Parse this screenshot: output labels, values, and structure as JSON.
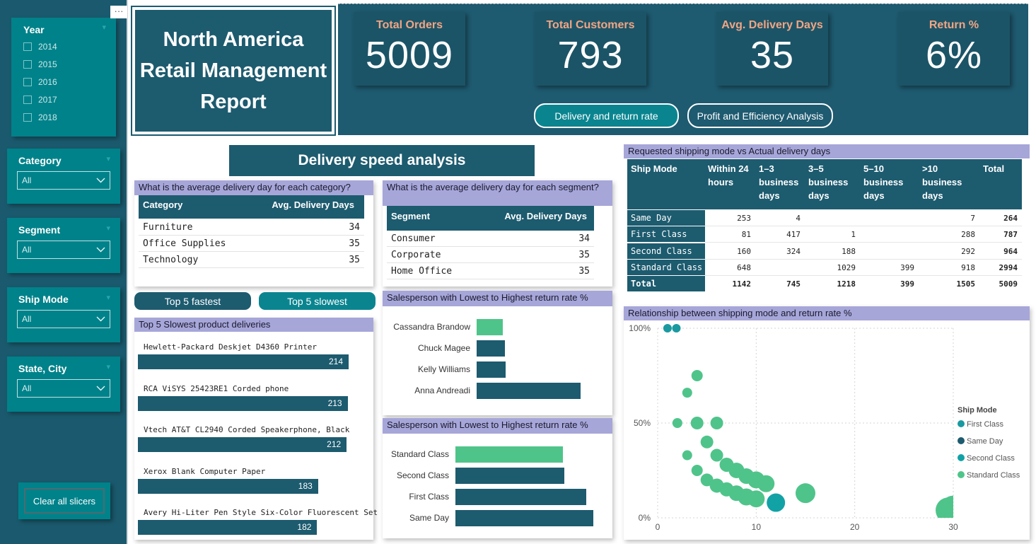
{
  "sidebar": {
    "year": {
      "title": "Year",
      "options": [
        "2014",
        "2015",
        "2016",
        "2017",
        "2018"
      ]
    },
    "category": {
      "title": "Category",
      "value": "All"
    },
    "segment": {
      "title": "Segment",
      "value": "All"
    },
    "ship_mode": {
      "title": "Ship Mode",
      "value": "All"
    },
    "state_city": {
      "title": "State, City",
      "value": "All"
    },
    "clear_label": "Clear all slicers",
    "more_label": "···"
  },
  "header": {
    "title_lines": [
      "North America",
      "Retail Management",
      "Report"
    ],
    "kpis": [
      {
        "label": "Total Orders",
        "value": "5009"
      },
      {
        "label": "Total Customers",
        "value": "793"
      },
      {
        "label": "Avg. Delivery Days",
        "value": "35"
      },
      {
        "label": "Return %",
        "value": "6%"
      }
    ],
    "nav": [
      "Delivery and return rate",
      "Profit and Efficiency Analysis"
    ]
  },
  "section_title": "Delivery speed analysis",
  "category_table": {
    "question": "What is the average delivery day for each category?",
    "headers": [
      "Category",
      "Avg. Delivery Days"
    ],
    "rows": [
      [
        "Furniture",
        "34"
      ],
      [
        "Office Supplies",
        "35"
      ],
      [
        "Technology",
        "35"
      ]
    ]
  },
  "segment_table": {
    "question": "What is the average delivery day for each segment?",
    "headers": [
      "Segment",
      "Avg. Delivery Days"
    ],
    "rows": [
      [
        "Consumer",
        "34"
      ],
      [
        "Corporate",
        "35"
      ],
      [
        "Home Office",
        "35"
      ]
    ]
  },
  "toggles": [
    "Top 5 fastest",
    "Top 5 slowest"
  ],
  "slowest": {
    "title": "Top 5 Slowest product deliveries",
    "items": [
      {
        "name": "Hewlett-Packard Deskjet D4360 Printer",
        "value": 214
      },
      {
        "name": "RCA ViSYS 25423RE1 Corded phone",
        "value": 213
      },
      {
        "name": "Vtech AT&T CL2940 Corded Speakerphone, Black",
        "value": 212
      },
      {
        "name": "Xerox Blank Computer Paper",
        "value": 183
      },
      {
        "name": "Avery Hi-Liter Pen Style Six-Color Fluorescent Set",
        "value": 182
      }
    ]
  },
  "salesperson_chart": {
    "title": "Salesperson with Lowest to Highest return rate %",
    "bars": [
      {
        "name": "Cassandra Brandow",
        "value": 0.25,
        "color": "#4fc48a"
      },
      {
        "name": "Chuck Magee",
        "value": 0.27,
        "color": "#1d5b6f"
      },
      {
        "name": "Kelly Williams",
        "value": 0.28,
        "color": "#1d5b6f"
      },
      {
        "name": "Anna Andreadi",
        "value": 1.0,
        "color": "#1d5b6f"
      }
    ]
  },
  "shipclass_chart": {
    "title": "Salesperson with Lowest to Highest return rate %",
    "bars": [
      {
        "name": "Standard Class",
        "value": 0.78,
        "color": "#4fc48a"
      },
      {
        "name": "Second Class",
        "value": 0.79,
        "color": "#1d5b6f"
      },
      {
        "name": "First Class",
        "value": 0.95,
        "color": "#1d5b6f"
      },
      {
        "name": "Same Day",
        "value": 1.0,
        "color": "#1d5b6f"
      }
    ]
  },
  "matrix": {
    "title": "Requested shipping mode vs Actual delivery days",
    "headers": [
      "Ship Mode",
      "Within 24 hours",
      "1–3 business days",
      "3–5 business days",
      "5–10 business days",
      ">10 business days",
      "Total"
    ],
    "rows": [
      [
        "Same Day",
        "253",
        "4",
        "",
        "",
        "7",
        "264"
      ],
      [
        "First Class",
        "81",
        "417",
        "1",
        "",
        "288",
        "787"
      ],
      [
        "Second Class",
        "160",
        "324",
        "188",
        "",
        "292",
        "964"
      ],
      [
        "Standard Class",
        "648",
        "",
        "1029",
        "399",
        "918",
        "2994"
      ],
      [
        "Total",
        "1142",
        "745",
        "1218",
        "399",
        "1505",
        "5009"
      ]
    ]
  },
  "chart_data": {
    "type": "scatter",
    "title": "Relationship between shipping mode and return rate %",
    "xlim": [
      0,
      30
    ],
    "ylim": [
      0,
      100
    ],
    "x_ticks": [
      "0",
      "10",
      "20",
      "30"
    ],
    "y_ticks": [
      "0%",
      "50%",
      "100%"
    ],
    "legend_title": "Ship Mode",
    "legend_position": "right",
    "series": [
      {
        "name": "First Class",
        "color": "#1a9aa0",
        "points": [
          [
            1,
            100,
            6
          ],
          [
            1.9,
            100,
            6
          ]
        ]
      },
      {
        "name": "Same Day",
        "color": "#1d5b6f",
        "points": []
      },
      {
        "name": "Second Class",
        "color": "#11a2a6",
        "points": [
          [
            12,
            8,
            13
          ]
        ]
      },
      {
        "name": "Standard Class",
        "color": "#4fc48a",
        "points": [
          [
            4,
            75,
            8
          ],
          [
            3,
            66,
            7
          ],
          [
            2,
            50,
            7
          ],
          [
            4,
            50,
            9
          ],
          [
            6,
            50,
            9
          ],
          [
            3,
            33,
            7
          ],
          [
            5,
            40,
            9
          ],
          [
            6,
            33,
            9
          ],
          [
            7,
            28,
            10
          ],
          [
            8,
            25,
            11
          ],
          [
            9,
            22,
            11
          ],
          [
            10,
            20,
            12
          ],
          [
            11,
            18,
            12
          ],
          [
            4,
            25,
            8
          ],
          [
            5,
            20,
            9
          ],
          [
            6,
            17,
            10
          ],
          [
            7,
            15,
            10
          ],
          [
            8,
            13,
            11
          ],
          [
            9,
            11,
            12
          ],
          [
            10,
            10,
            12
          ],
          [
            15,
            13,
            14
          ],
          [
            29.5,
            4,
            18
          ],
          [
            30,
            5,
            18
          ]
        ]
      }
    ]
  }
}
